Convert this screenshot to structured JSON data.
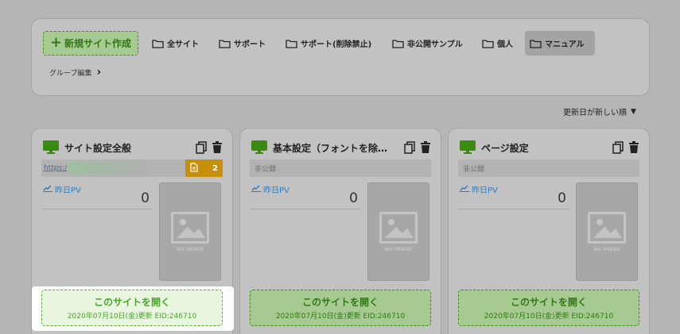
{
  "toolbar": {
    "new_site": "新規サイト作成",
    "groups": [
      {
        "label": "全サイト"
      },
      {
        "label": "サポート"
      },
      {
        "label": "サポート(削除禁止)"
      },
      {
        "label": "非公開サンプル"
      },
      {
        "label": "個人"
      },
      {
        "label": "マニュアル",
        "active": true
      }
    ],
    "group_edit": "グループ編集"
  },
  "sort": {
    "label": "更新日が新しい順",
    "icon": "caret-down-icon"
  },
  "cards": [
    {
      "title": "サイト設定全般",
      "url_text": "https:/",
      "badge_count": "2",
      "pv_label": "昨日PV",
      "pv_value": "0",
      "noimage_text": "NO IMAGE",
      "open_label": "このサイトを開く",
      "updated": "2020年07月10日(金)更新 EID:246710"
    },
    {
      "title": "基本設定（フォントを除…",
      "status": "非公開",
      "pv_label": "昨日PV",
      "pv_value": "0",
      "noimage_text": "NO IMAGE",
      "open_label": "このサイトを開く",
      "updated": "2020年07月10日(金)更新 EID:246710"
    },
    {
      "title": "ページ設定",
      "status": "非公開",
      "pv_label": "昨日PV",
      "pv_value": "0",
      "noimage_text": "NO IMAGE",
      "open_label": "このサイトを開く",
      "updated": "2020年07月10日(金)更新 EID:246710"
    }
  ],
  "colors": {
    "accent_green": "#4aa52b",
    "badge_gold": "#c58f0a",
    "pv_blue": "#2d7ec0",
    "overlay_gray": "#b5b5b5"
  }
}
